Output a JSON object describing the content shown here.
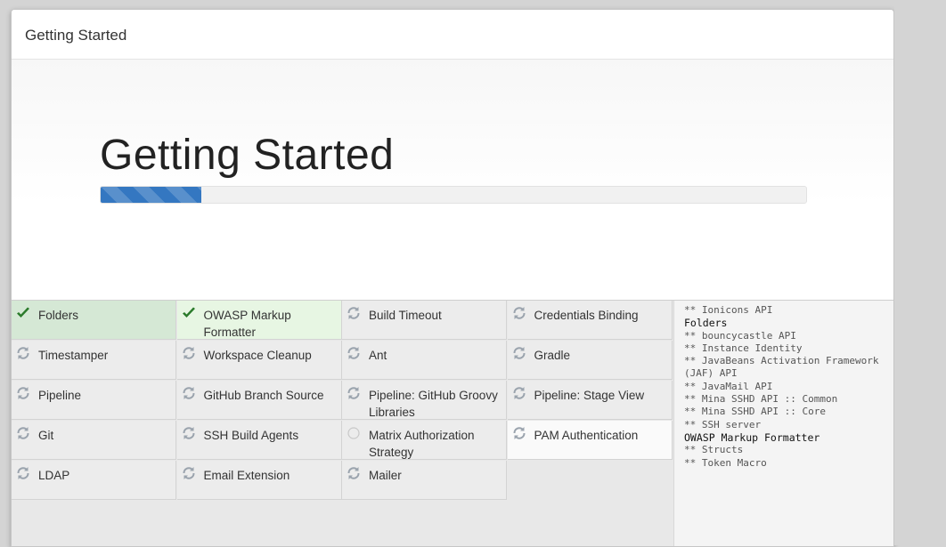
{
  "dialog": {
    "title": "Getting Started"
  },
  "hero": {
    "title": "Getting Started",
    "progress_fraction": 0.143
  },
  "plugins": [
    {
      "label": "Folders",
      "status": "done"
    },
    {
      "label": "OWASP Markup Formatter",
      "status": "done"
    },
    {
      "label": "Build Timeout",
      "status": "pending"
    },
    {
      "label": "Credentials Binding",
      "status": "pending"
    },
    {
      "label": "Timestamper",
      "status": "pending"
    },
    {
      "label": "Workspace Cleanup",
      "status": "pending"
    },
    {
      "label": "Ant",
      "status": "pending"
    },
    {
      "label": "Gradle",
      "status": "pending"
    },
    {
      "label": "Pipeline",
      "status": "pending"
    },
    {
      "label": "GitHub Branch Source",
      "status": "pending"
    },
    {
      "label": "Pipeline: GitHub Groovy Libraries",
      "status": "pending"
    },
    {
      "label": "Pipeline: Stage View",
      "status": "pending"
    },
    {
      "label": "Git",
      "status": "pending"
    },
    {
      "label": "SSH Build Agents",
      "status": "pending"
    },
    {
      "label": "Matrix Authorization Strategy",
      "status": "idle"
    },
    {
      "label": "PAM Authentication",
      "status": "pending"
    },
    {
      "label": "LDAP",
      "status": "pending"
    },
    {
      "label": "Email Extension",
      "status": "pending"
    },
    {
      "label": "Mailer",
      "status": "pending"
    }
  ],
  "log": [
    {
      "text": "** Ionicons API",
      "highlight": false
    },
    {
      "text": "Folders",
      "highlight": true
    },
    {
      "text": "** bouncycastle API",
      "highlight": false
    },
    {
      "text": "** Instance Identity",
      "highlight": false
    },
    {
      "text": "** JavaBeans Activation Framework (JAF) API",
      "highlight": false
    },
    {
      "text": "** JavaMail API",
      "highlight": false
    },
    {
      "text": "** Mina SSHD API :: Common",
      "highlight": false
    },
    {
      "text": "** Mina SSHD API :: Core",
      "highlight": false
    },
    {
      "text": "** SSH server",
      "highlight": false
    },
    {
      "text": "OWASP Markup Formatter",
      "highlight": true
    },
    {
      "text": "** Structs",
      "highlight": false
    },
    {
      "text": "** Token Macro",
      "highlight": false
    }
  ],
  "colors": {
    "accent": "#3477c1",
    "done": "#d5e8d5",
    "check": "#2a7a2a",
    "spinner": "#9aa3ad"
  }
}
